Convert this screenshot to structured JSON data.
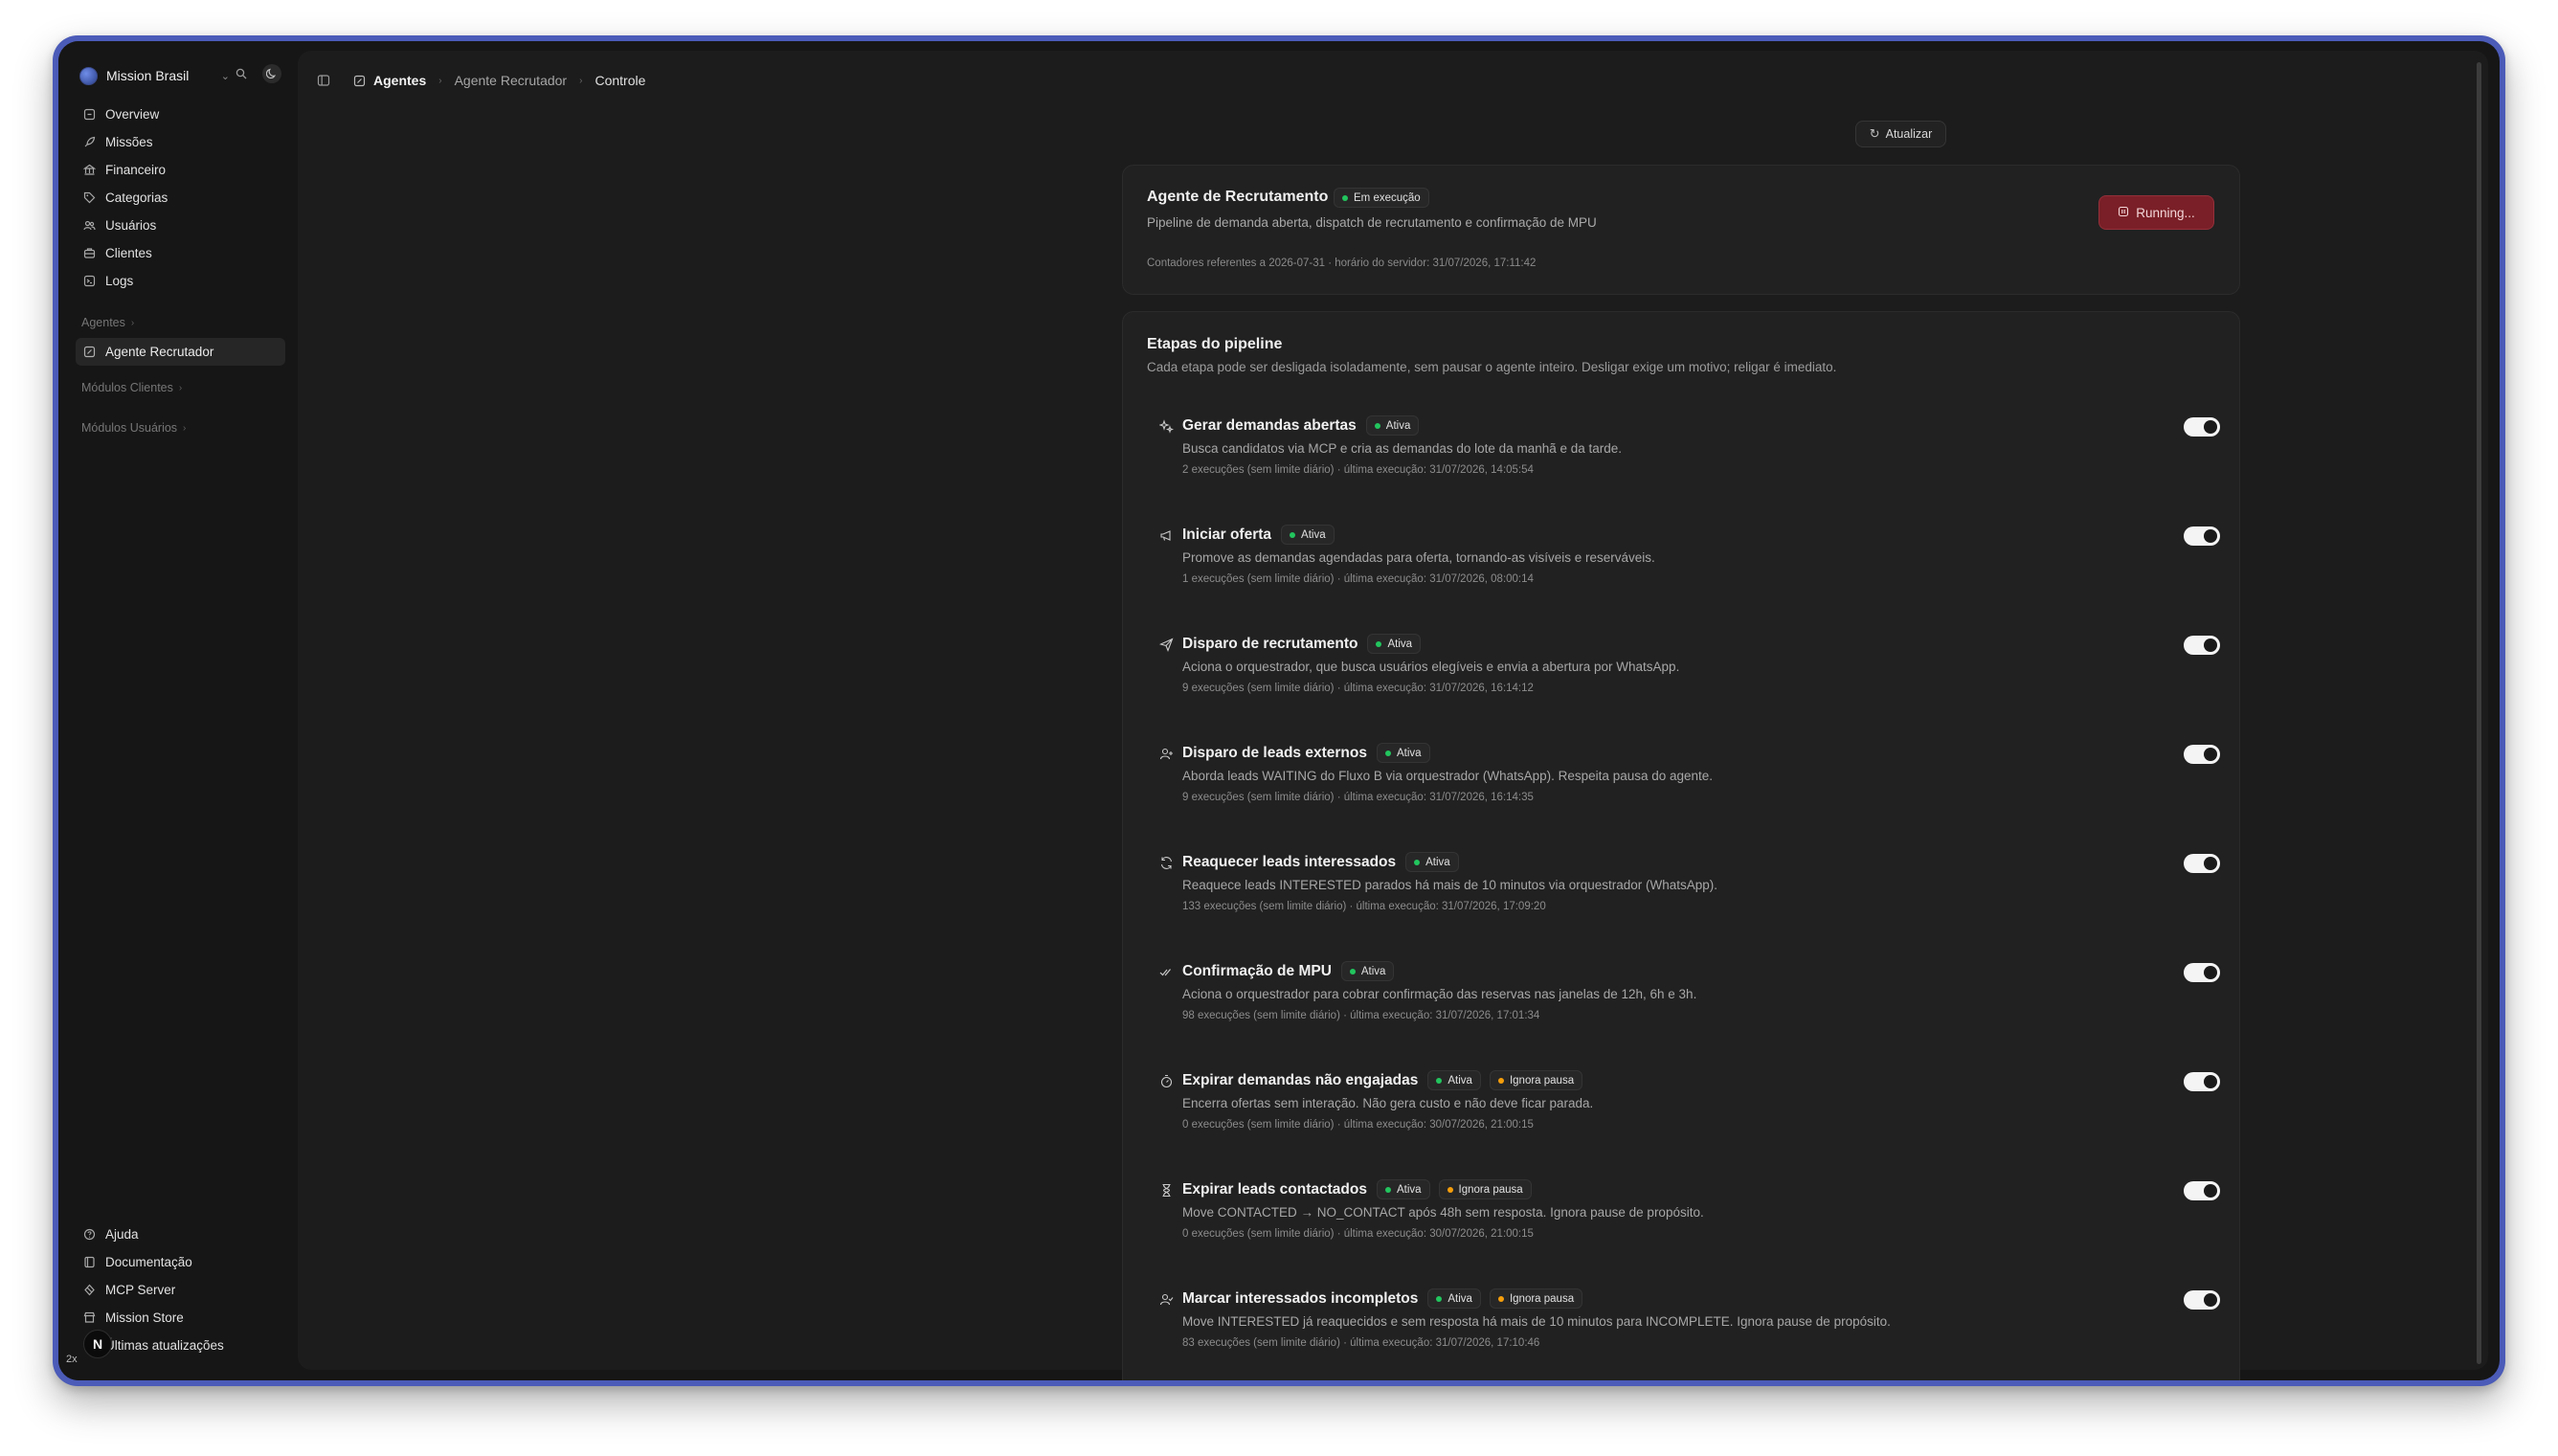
{
  "brand": {
    "name": "Mission Brasil"
  },
  "sidebar": {
    "items": [
      {
        "label": "Overview",
        "icon": "home-icon"
      },
      {
        "label": "Missões",
        "icon": "rocket-icon"
      },
      {
        "label": "Financeiro",
        "icon": "bank-icon"
      },
      {
        "label": "Categorias",
        "icon": "tag-icon"
      },
      {
        "label": "Usuários",
        "icon": "users-icon"
      },
      {
        "label": "Clientes",
        "icon": "briefcase-icon"
      },
      {
        "label": "Logs",
        "icon": "terminal-icon"
      }
    ],
    "section_agents": "Agentes",
    "active_item": "Agente Recrutador",
    "section_clients": "Módulos Clientes",
    "section_users": "Módulos Usuários",
    "bottom_items": [
      {
        "label": "Ajuda",
        "icon": "help-icon"
      },
      {
        "label": "Documentação",
        "icon": "book-icon"
      },
      {
        "label": "MCP Server",
        "icon": "plug-icon"
      },
      {
        "label": "Mission Store",
        "icon": "store-icon"
      },
      {
        "label": "Últimas atualizações",
        "icon": "sparkle-icon"
      }
    ],
    "fab_label": "N",
    "corner_tag": "2x"
  },
  "breadcrumb": {
    "root": "Agentes",
    "parent": "Agente Recrutador",
    "current": "Controle"
  },
  "toolbar": {
    "refresh_label": "Atualizar"
  },
  "agent": {
    "title": "Agente de Recrutamento",
    "status": "Em execução",
    "description": "Pipeline de demanda aberta, dispatch de recrutamento e confirmação de MPU",
    "meta": "Contadores referentes a 2026-07-31 · horário do servidor: 31/07/2026, 17:11:42",
    "run_button": "Running..."
  },
  "pipeline": {
    "title": "Etapas do pipeline",
    "subtitle": "Cada etapa pode ser desligada isoladamente, sem pausar o agente inteiro. Desligar exige um motivo; religar é imediato.",
    "stages": [
      {
        "name": "Gerar demandas abertas",
        "status": "Ativa",
        "ignore": "",
        "description": "Busca candidatos via MCP e cria as demandas do lote da manhã e da tarde.",
        "meta": "2 execuções (sem limite diário) · última execução: 31/07/2026, 14:05:54",
        "enabled": true,
        "icon": "sparkles-icon"
      },
      {
        "name": "Iniciar oferta",
        "status": "Ativa",
        "ignore": "",
        "description": "Promove as demandas agendadas para oferta, tornando-as visíveis e reserváveis.",
        "meta": "1 execuções (sem limite diário) · última execução: 31/07/2026, 08:00:14",
        "enabled": true,
        "icon": "megaphone-icon"
      },
      {
        "name": "Disparo de recrutamento",
        "status": "Ativa",
        "ignore": "",
        "description": "Aciona o orquestrador, que busca usuários elegíveis e envia a abertura por WhatsApp.",
        "meta": "9 execuções (sem limite diário) · última execução: 31/07/2026, 16:14:12",
        "enabled": true,
        "icon": "send-icon"
      },
      {
        "name": "Disparo de leads externos",
        "status": "Ativa",
        "ignore": "",
        "description": "Aborda leads WAITING do Fluxo B via orquestrador (WhatsApp). Respeita pausa do agente.",
        "meta": "9 execuções (sem limite diário) · última execução: 31/07/2026, 16:14:35",
        "enabled": true,
        "icon": "user-plus-icon"
      },
      {
        "name": "Reaquecer leads interessados",
        "status": "Ativa",
        "ignore": "",
        "description": "Reaquece leads INTERESTED parados há mais de 10 minutos via orquestrador (WhatsApp).",
        "meta": "133 execuções (sem limite diário) · última execução: 31/07/2026, 17:09:20",
        "enabled": true,
        "icon": "refresh-icon"
      },
      {
        "name": "Confirmação de MPU",
        "status": "Ativa",
        "ignore": "",
        "description": "Aciona o orquestrador para cobrar confirmação das reservas nas janelas de 12h, 6h e 3h.",
        "meta": "98 execuções (sem limite diário) · última execução: 31/07/2026, 17:01:34",
        "enabled": true,
        "icon": "double-check-icon"
      },
      {
        "name": "Expirar demandas não engajadas",
        "status": "Ativa",
        "ignore": "Ignora pausa",
        "description": "Encerra ofertas sem interação. Não gera custo e não deve ficar parada.",
        "meta": "0 execuções (sem limite diário) · última execução: 30/07/2026, 21:00:15",
        "enabled": true,
        "icon": "timer-icon"
      },
      {
        "name": "Expirar leads contactados",
        "status": "Ativa",
        "ignore": "Ignora pausa",
        "description": "Move CONTACTED → NO_CONTACT após 48h sem resposta. Ignora pause de propósito.",
        "meta": "0 execuções (sem limite diário) · última execução: 30/07/2026, 21:00:15",
        "enabled": true,
        "icon": "hourglass-icon"
      },
      {
        "name": "Marcar interessados incompletos",
        "status": "Ativa",
        "ignore": "Ignora pausa",
        "description": "Move INTERESTED já reaquecidos e sem resposta há mais de 10 minutos para INCOMPLETE. Ignora pause de propósito.",
        "meta": "83 execuções (sem limite diário) · última execução: 31/07/2026, 17:10:46",
        "enabled": true,
        "icon": "user-check-icon"
      }
    ]
  },
  "colors": {
    "active": "#22c55e",
    "ignore": "#f59e0b",
    "running": "#7a1f27",
    "accent": "#4b5bb8"
  }
}
